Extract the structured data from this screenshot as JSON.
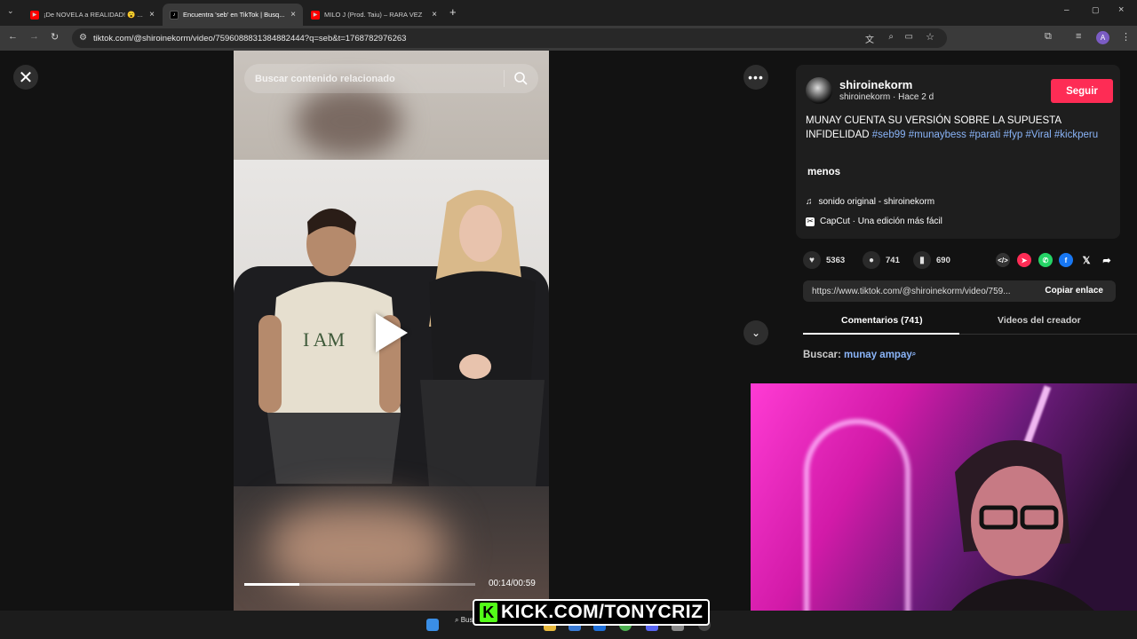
{
  "browser": {
    "tabs": [
      {
        "title": "¡De NOVELA a REALIDAD! 😮 ...",
        "favicon": "youtube-icon",
        "active": false
      },
      {
        "title": "Encuentra 'seb' en TikTok | Busq...",
        "favicon": "tiktok-icon",
        "active": true
      },
      {
        "title": "MILO J (Prod. Taiu) – RARA VEZ",
        "favicon": "youtube-icon",
        "active": false
      }
    ],
    "url": "tiktok.com/@shiroinekorm/video/7596088831384882444?q=seb&t=1768782976263",
    "profile_initial": "A"
  },
  "video": {
    "search_placeholder": "Buscar contenido relacionado",
    "time": "00:14/00:59",
    "progress_fraction": 0.24
  },
  "post": {
    "username": "shiroinekorm",
    "subline": "shiroinekorm · Hace 2 d",
    "follow_label": "Seguir",
    "description_text": "MUNAY CUENTA SU VERSIÓN SOBRE LA SUPUESTA INFIDELIDAD",
    "hashtags": [
      "#seb99",
      "#munaybess",
      "#parati",
      "#fyp",
      "#Viral",
      "#kickperu"
    ],
    "less_label": "menos",
    "sound": "sonido original - shiroinekorm",
    "capcut": "CapCut · Una edición más fácil",
    "likes": "5363",
    "comments": "741",
    "saves": "690",
    "link": "https://www.tiktok.com/@shiroinekorm/video/759...",
    "copy_label": "Copiar enlace",
    "tab_comments": "Comentarios (741)",
    "tab_creator": "Videos del creador",
    "search_label": "Buscar:",
    "search_query": "munay ampay"
  },
  "overlay": {
    "kick_text": "KICK.COM/TONYCRIZ",
    "taskbar_search": "Buscar"
  },
  "colors": {
    "follow": "#fe2c55",
    "hashtag": "#8ab4f8",
    "kick_green": "#53fc18"
  }
}
